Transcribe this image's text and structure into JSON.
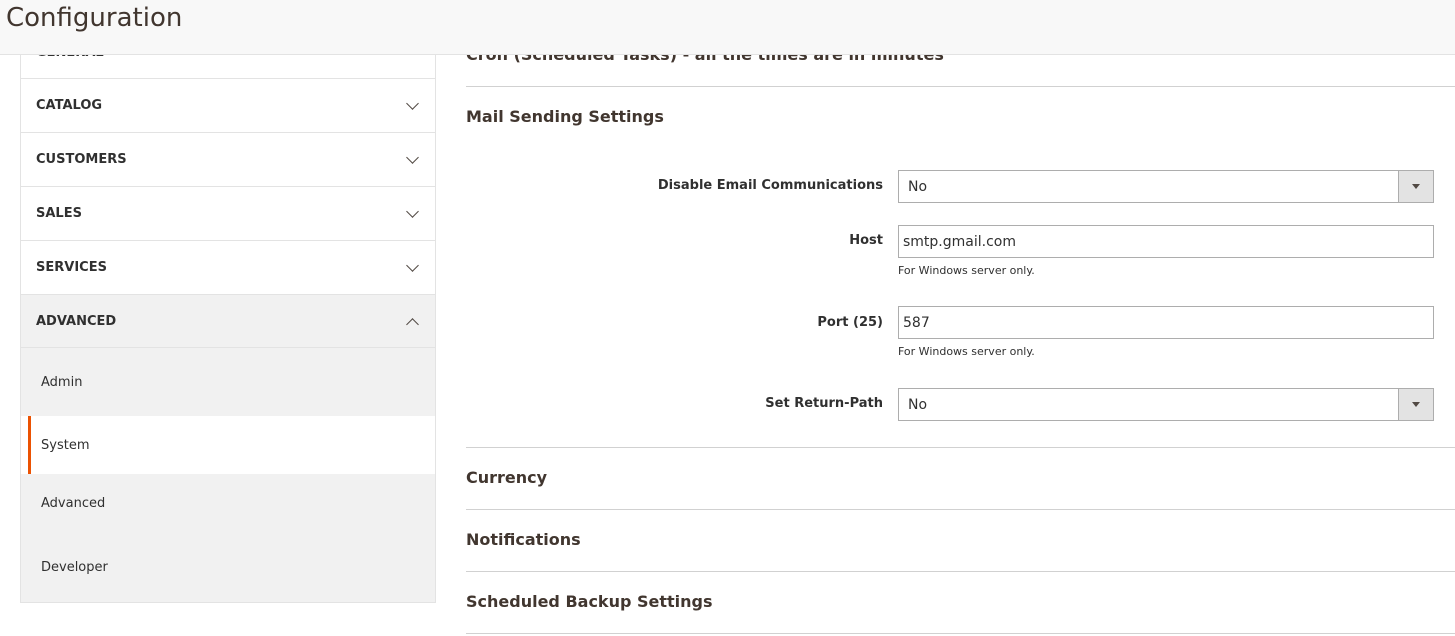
{
  "header": {
    "title": "Configuration"
  },
  "sidebar": {
    "sections": [
      {
        "label": "GENERAL",
        "expanded": false
      },
      {
        "label": "CATALOG",
        "expanded": false
      },
      {
        "label": "CUSTOMERS",
        "expanded": false
      },
      {
        "label": "SALES",
        "expanded": false
      },
      {
        "label": "SERVICES",
        "expanded": false
      },
      {
        "label": "ADVANCED",
        "expanded": true
      }
    ],
    "advanced_items": [
      {
        "label": "Admin",
        "active": false
      },
      {
        "label": "System",
        "active": true
      },
      {
        "label": "Advanced",
        "active": false
      },
      {
        "label": "Developer",
        "active": false
      }
    ],
    "accent": "#eb5202"
  },
  "main": {
    "cron_title": "Cron (Scheduled Tasks) - all the times are in minutes",
    "mail": {
      "title": "Mail Sending Settings",
      "disable_label": "Disable Email Communications",
      "disable_value": "No",
      "host_label": "Host",
      "host_value": "smtp.gmail.com",
      "host_note": "For Windows server only.",
      "port_label": "Port (25)",
      "port_value": "587",
      "port_note": "For Windows server only.",
      "return_label": "Set Return-Path",
      "return_value": "No"
    },
    "currency_title": "Currency",
    "notifications_title": "Notifications",
    "backup_title": "Scheduled Backup Settings"
  }
}
